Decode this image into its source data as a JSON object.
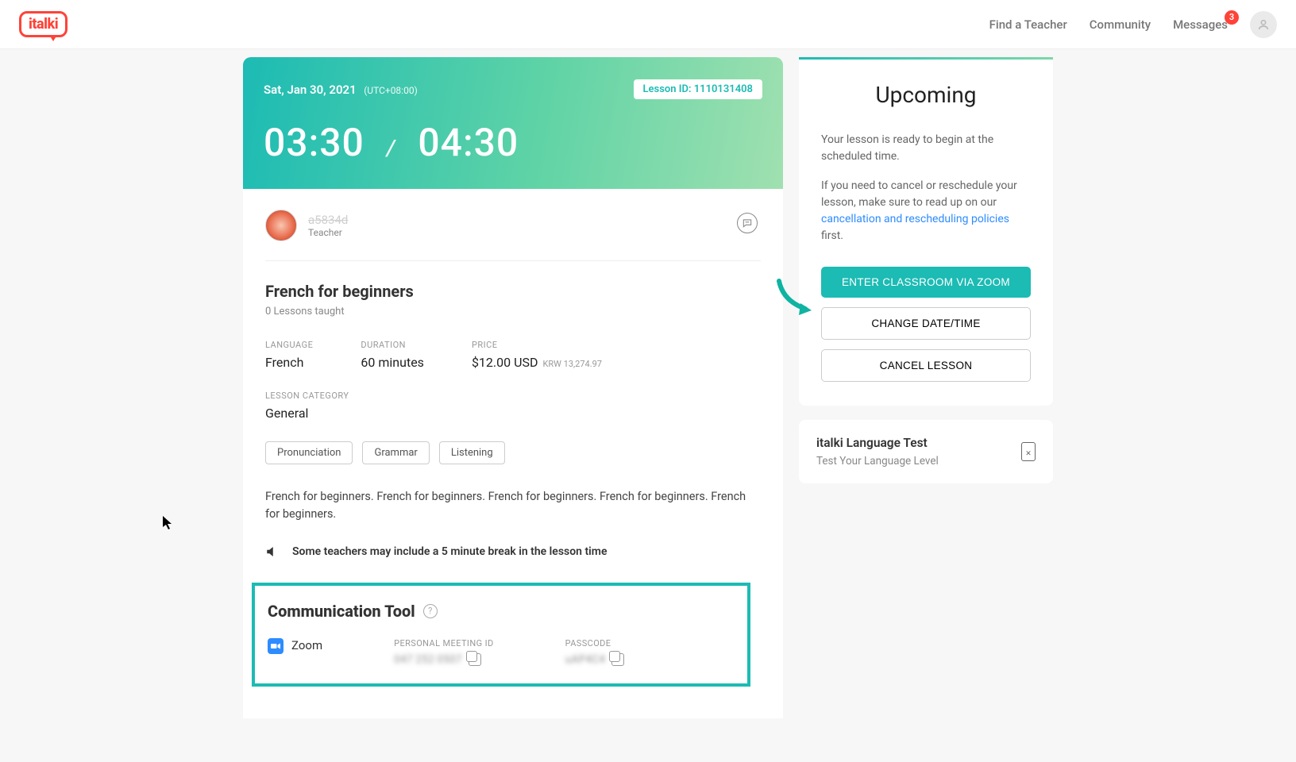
{
  "brand": {
    "name": "italki"
  },
  "nav": {
    "find_teacher": "Find a Teacher",
    "community": "Community",
    "messages": "Messages",
    "messages_badge": "3"
  },
  "hero": {
    "date": "Sat, Jan 30, 2021",
    "timezone": "(UTC+08:00)",
    "lesson_id_label": "Lesson ID: 1110131408",
    "start_time": "03:30",
    "end_time": "04:30"
  },
  "teacher": {
    "name": "a5834d",
    "role": "Teacher"
  },
  "course": {
    "title": "French for beginners",
    "subtitle": "0 Lessons taught",
    "language_label": "LANGUAGE",
    "language": "French",
    "duration_label": "DURATION",
    "duration": "60 minutes",
    "price_label": "PRICE",
    "price": "$12.00 USD",
    "price_sub": "KRW 13,274.97",
    "category_label": "LESSON CATEGORY",
    "category": "General",
    "tags": [
      "Pronunciation",
      "Grammar",
      "Listening"
    ],
    "description": "French for beginners. French for beginners. French for beginners. French for beginners. French for beginners.",
    "break_note": "Some teachers may include a 5 minute break in the lesson time"
  },
  "comm": {
    "title": "Communication Tool",
    "tool": "Zoom",
    "meeting_id_label": "PERSONAL MEETING ID",
    "meeting_id": "047 252 0507",
    "passcode_label": "PASSCODE",
    "passcode": "uAP4C4"
  },
  "sidebar": {
    "title": "Upcoming",
    "text1": "Your lesson is ready to begin at the scheduled time.",
    "text2_pre": "If you need to cancel or reschedule your lesson, make sure to read up on our ",
    "text2_link": "cancellation and rescheduling policies",
    "text2_post": " first.",
    "enter_btn": "ENTER CLASSROOM VIA ZOOM",
    "change_btn": "CHANGE DATE/TIME",
    "cancel_btn": "CANCEL LESSON"
  },
  "promo": {
    "title": "italki Language Test",
    "subtitle": "Test Your Language Level"
  }
}
